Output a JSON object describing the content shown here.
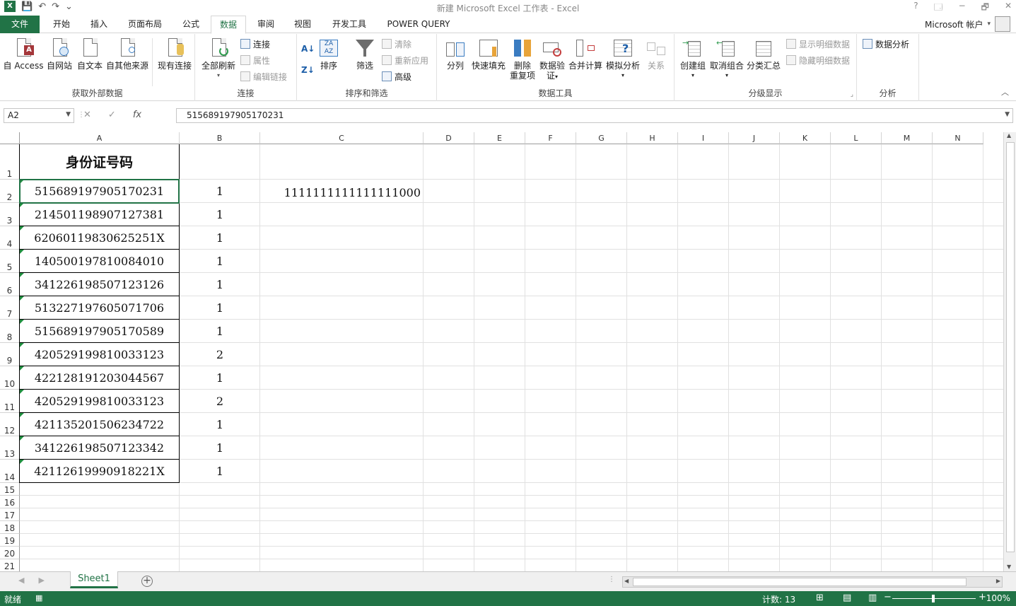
{
  "window": {
    "title": "新建 Microsoft Excel 工作表 - Excel",
    "help": "?",
    "restore_ribbon": "🗔",
    "minimize": "−",
    "maximize": "🗗",
    "close": "✕"
  },
  "qat": {
    "logo": "X",
    "save": "💾",
    "undo": "↶",
    "redo": "↷",
    "customize": "⌄"
  },
  "tabs": [
    {
      "label": "文件"
    },
    {
      "label": "开始"
    },
    {
      "label": "插入"
    },
    {
      "label": "页面布局"
    },
    {
      "label": "公式"
    },
    {
      "label": "数据"
    },
    {
      "label": "审阅"
    },
    {
      "label": "视图"
    },
    {
      "label": "开发工具"
    },
    {
      "label": "POWER QUERY"
    }
  ],
  "account": {
    "label": "Microsoft 帐户"
  },
  "ribbon": {
    "get_external": {
      "label": "获取外部数据",
      "access": "自 Access",
      "web": "自网站",
      "text": "自文本",
      "other": "自其他来源",
      "existing": "现有连接"
    },
    "connections": {
      "label": "连接",
      "refresh_all": "全部刷新",
      "connections": "连接",
      "properties": "属性",
      "edit_links": "编辑链接"
    },
    "sort_filter": {
      "label": "排序和筛选",
      "sort": "排序",
      "filter": "筛选",
      "clear": "清除",
      "reapply": "重新应用",
      "advanced": "高级"
    },
    "data_tools": {
      "label": "数据工具",
      "text_to_columns": "分列",
      "flash_fill": "快速填充",
      "remove_dup_1": "删除",
      "remove_dup_2": "重复项",
      "validation_1": "数据验",
      "validation_2": "证",
      "consolidate": "合并计算",
      "what_if": "模拟分析",
      "relationships": "关系"
    },
    "outline": {
      "label": "分级显示",
      "group": "创建组",
      "ungroup": "取消组合",
      "subtotal": "分类汇总",
      "show_detail": "显示明细数据",
      "hide_detail": "隐藏明细数据"
    },
    "analysis": {
      "label": "分析",
      "data_analysis": "数据分析"
    }
  },
  "formula_bar": {
    "name_box": "A2",
    "cancel": "✕",
    "enter": "✓",
    "fx": "fx",
    "value": "515689197905170231"
  },
  "columns": [
    "A",
    "B",
    "C",
    "D",
    "E",
    "F",
    "G",
    "H",
    "I",
    "J",
    "K",
    "L",
    "M",
    "N"
  ],
  "rows": [
    "1",
    "2",
    "3",
    "4",
    "5",
    "6",
    "7",
    "8",
    "9",
    "10",
    "11",
    "12",
    "13",
    "14",
    "15",
    "16",
    "17",
    "18",
    "19",
    "20",
    "21"
  ],
  "cells": {
    "A1": "身份证号码",
    "A": [
      "515689197905170231",
      "214501198907127381",
      "62060119830625251X",
      "140500197810084010",
      "341226198507123126",
      "513227197605071706",
      "515689197905170589",
      "420529199810033123",
      "422128191203044567",
      "420529199810033123",
      "421135201506234722",
      "341226198507123342",
      "42112619990918221X"
    ],
    "B": [
      "1",
      "1",
      "1",
      "1",
      "1",
      "1",
      "1",
      "2",
      "1",
      "2",
      "1",
      "1",
      "1"
    ],
    "C2": "1111111111111111000"
  },
  "sheet_tabs": [
    {
      "label": "Sheet1"
    }
  ],
  "add_sheet": "+",
  "status": {
    "ready": "就绪",
    "count": "计数: 13",
    "zoom": "100%"
  }
}
